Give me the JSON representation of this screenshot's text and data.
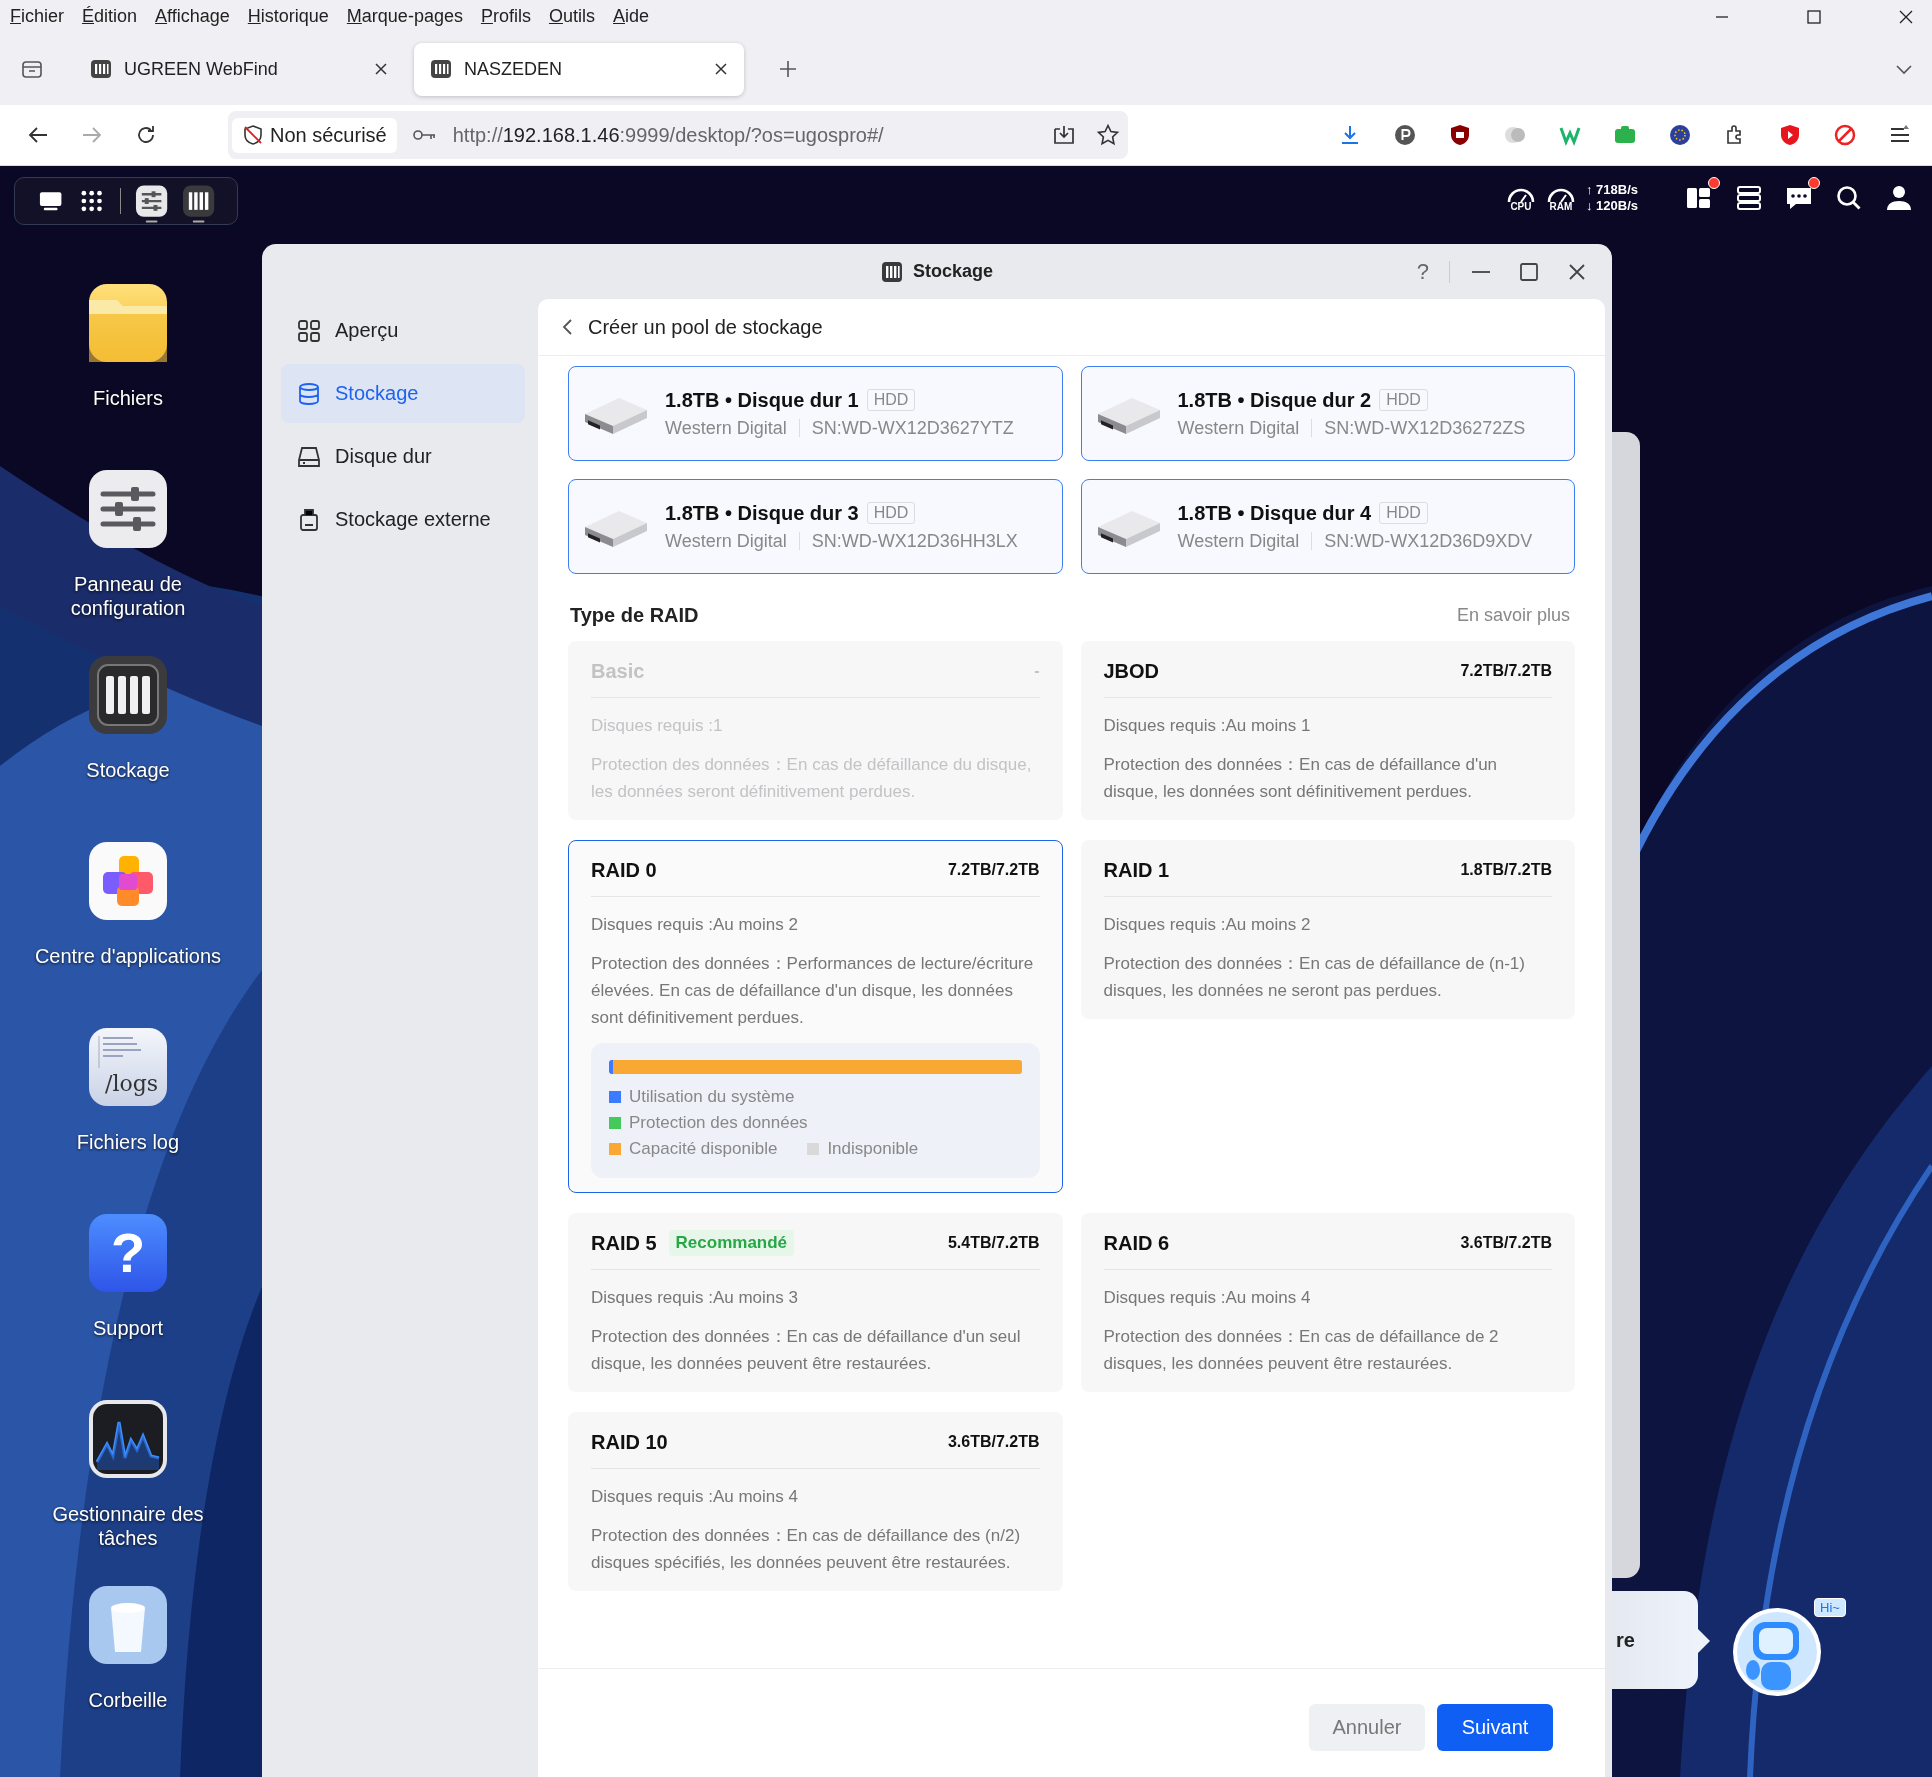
{
  "browser": {
    "menu": [
      "Fichier",
      "Édition",
      "Affichage",
      "Historique",
      "Marque-pages",
      "Profils",
      "Outils",
      "Aide"
    ],
    "tabs": [
      {
        "label": "UGREEN WebFind",
        "selected": false
      },
      {
        "label": "NASZEDEN",
        "selected": true
      }
    ],
    "address": {
      "security": "Non sécurisé",
      "url_scheme": "http://",
      "url_host": "192.168.1.46",
      "url_path": ":9999/desktop/?os=ugospro#/"
    }
  },
  "desktop": {
    "monitor": {
      "cpu": "CPU",
      "ram": "RAM",
      "upload": "↑ 718B/s",
      "download": "↓ 120B/s"
    },
    "tray": [
      {
        "kind": "widgets",
        "badge": true
      },
      {
        "kind": "servers",
        "badge": false
      },
      {
        "kind": "chat",
        "badge": true
      },
      {
        "kind": "search",
        "badge": false
      },
      {
        "kind": "user",
        "badge": false
      }
    ],
    "apps": [
      {
        "kind": "files",
        "label": "Fichiers"
      },
      {
        "kind": "settings",
        "label": "Panneau de configuration"
      },
      {
        "kind": "storage",
        "label": "Stockage"
      },
      {
        "kind": "appcenter",
        "label": "Centre d'applications"
      },
      {
        "kind": "logs",
        "label": "Fichiers log",
        "icon_text": "/logs"
      },
      {
        "kind": "support",
        "label": "Support",
        "icon_text": "?"
      },
      {
        "kind": "tasks",
        "label": "Gestionnaire des tâches"
      },
      {
        "kind": "trash",
        "label": "Corbeille"
      }
    ],
    "assistant": {
      "bubble_text": "re",
      "greeting": "Hi~"
    }
  },
  "window": {
    "title": "Stockage",
    "help": "?",
    "sidebar": [
      {
        "kind": "overview",
        "label": "Aperçu",
        "selected": false
      },
      {
        "kind": "storage",
        "label": "Stockage",
        "selected": true
      },
      {
        "kind": "disk",
        "label": "Disque dur",
        "selected": false
      },
      {
        "kind": "external",
        "label": "Stockage externe",
        "selected": false
      }
    ],
    "page_title": "Créer un pool de stockage",
    "disks": [
      {
        "title": "1.8TB • Disque dur 1",
        "type": "HDD",
        "vendor": "Western Digital",
        "serial": "SN:WD-WX12D3627YTZ"
      },
      {
        "title": "1.8TB • Disque dur 2",
        "type": "HDD",
        "vendor": "Western Digital",
        "serial": "SN:WD-WX12D36272ZS"
      },
      {
        "title": "1.8TB • Disque dur 3",
        "type": "HDD",
        "vendor": "Western Digital",
        "serial": "SN:WD-WX12D36HH3LX"
      },
      {
        "title": "1.8TB • Disque dur 4",
        "type": "HDD",
        "vendor": "Western Digital",
        "serial": "SN:WD-WX12D36D9XDV"
      }
    ],
    "raid_section": {
      "title": "Type de RAID",
      "link": "En savoir plus"
    },
    "raid_options": [
      {
        "name": "Basic",
        "capacity": "-",
        "disabled": true,
        "selected": false,
        "requirement": "Disques requis :1",
        "protection": "Protection des données：En cas de défaillance du disque, les données seront définitivement perdues."
      },
      {
        "name": "JBOD",
        "capacity": "7.2TB/7.2TB",
        "disabled": false,
        "selected": false,
        "requirement": "Disques requis :Au moins 1",
        "protection": "Protection des données：En cas de défaillance d'un disque, les données sont définitivement perdues."
      },
      {
        "name": "RAID 0",
        "capacity": "7.2TB/7.2TB",
        "disabled": false,
        "selected": true,
        "requirement": "Disques requis :Au moins 2",
        "protection": "Protection des données：Performances de lecture/écriture élevées. En cas de défaillance d'un disque, les données sont définitivement perdues.",
        "usage": [
          {
            "label": "Utilisation du système",
            "color": "#3b7bff",
            "level": 0.01
          },
          {
            "label": "Protection des données",
            "color": "#44c95a"
          },
          {
            "label": "Capacité disponible",
            "color": "#f9a833",
            "level": 0.99
          },
          {
            "label": "Indisponible",
            "color": "#d9d9d9"
          }
        ]
      },
      {
        "name": "RAID 1",
        "capacity": "1.8TB/7.2TB",
        "disabled": false,
        "selected": false,
        "requirement": "Disques requis :Au moins 2",
        "protection": "Protection des données：En cas de défaillance de (n-1) disques, les données ne seront pas perdues."
      },
      {
        "name": "RAID 5",
        "badge": "Recommandé",
        "capacity": "5.4TB/7.2TB",
        "disabled": false,
        "selected": false,
        "requirement": "Disques requis :Au moins 3",
        "protection": "Protection des données：En cas de défaillance d'un seul disque, les données peuvent être restaurées."
      },
      {
        "name": "RAID 6",
        "capacity": "3.6TB/7.2TB",
        "disabled": false,
        "selected": false,
        "requirement": "Disques requis :Au moins 4",
        "protection": "Protection des données：En cas de défaillance de 2 disques, les données peuvent être restaurées."
      },
      {
        "name": "RAID 10",
        "capacity": "3.6TB/7.2TB",
        "disabled": false,
        "selected": false,
        "requirement": "Disques requis :Au moins 4",
        "protection": "Protection des données：En cas de défaillance des (n/2) disques spécifiés, les données peuvent être restaurées."
      }
    ],
    "buttons": [
      {
        "kind": "secondary",
        "label": "Annuler"
      },
      {
        "kind": "primary",
        "label": "Suivant"
      }
    ]
  }
}
